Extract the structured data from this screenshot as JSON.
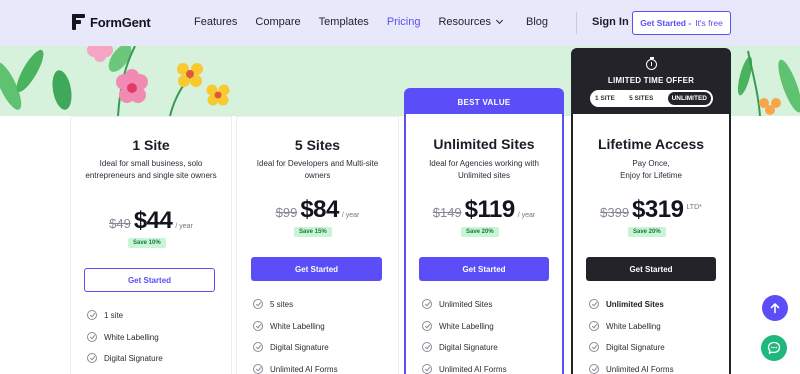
{
  "nav": {
    "logo_text": "FormGent",
    "items": [
      {
        "label": "Features"
      },
      {
        "label": "Compare"
      },
      {
        "label": "Templates"
      },
      {
        "label": "Pricing",
        "active": true
      },
      {
        "label": "Resources",
        "has_dropdown": true
      },
      {
        "label": "Blog"
      }
    ],
    "sign_in": "Sign In",
    "cta_label": "Get Started -",
    "cta_note": "It's free"
  },
  "colors": {
    "accent": "#5b4df7",
    "dark": "#232329",
    "hero_green": "#d6f2dc",
    "save_bg": "#c9f4d6",
    "save_text": "#187a3a",
    "chat_green": "#1fb87c"
  },
  "plans": [
    {
      "title": "1 Site",
      "description": "Ideal for small business, solo entrepreneurs and single site owners",
      "old_price": "$49",
      "price": "$44",
      "period": "/ year",
      "save": "Save 10%",
      "button": "Get Started",
      "features": [
        "1 site",
        "White Labelling",
        "Digital Signature"
      ]
    },
    {
      "title": "5 Sites",
      "description": "Ideal for Developers and Multi-site owners",
      "old_price": "$99",
      "price": "$84",
      "period": "/ year",
      "save": "Save 15%",
      "button": "Get Started",
      "features": [
        "5 sites",
        "White Labelling",
        "Digital Signature",
        "Unlimited AI Forms"
      ]
    },
    {
      "badge": "BEST VALUE",
      "title": "Unlimited Sites",
      "description": "Ideal for Agencies working with Unlimited sites",
      "old_price": "$149",
      "price": "$119",
      "period": "/ year",
      "save": "Save 20%",
      "button": "Get Started",
      "features": [
        "Unlimited Sites",
        "White Labelling",
        "Digital Signature",
        "Unlimited AI Forms"
      ]
    },
    {
      "badge": "LIMITED TIME OFFER",
      "segments": [
        "1 SITE",
        "5 SITES",
        "UNLIMITED"
      ],
      "selected_segment": "UNLIMITED",
      "title": "Lifetime Access",
      "description_line1": "Pay Once,",
      "description_line2": "Enjoy for Lifetime",
      "old_price": "$399",
      "price": "$319",
      "period": "LTD*",
      "save": "Save 20%",
      "button": "Get Started",
      "features": [
        "Unlimited Sites",
        "White Labelling",
        "Digital Signature",
        "Unlimited AI Forms"
      ]
    }
  ],
  "icons": {
    "logo": "formgent-logo-icon",
    "check": "check-circle-icon",
    "timer": "stopwatch-icon",
    "scroll_top": "arrow-up-icon",
    "chat": "chat-bubble-icon"
  }
}
